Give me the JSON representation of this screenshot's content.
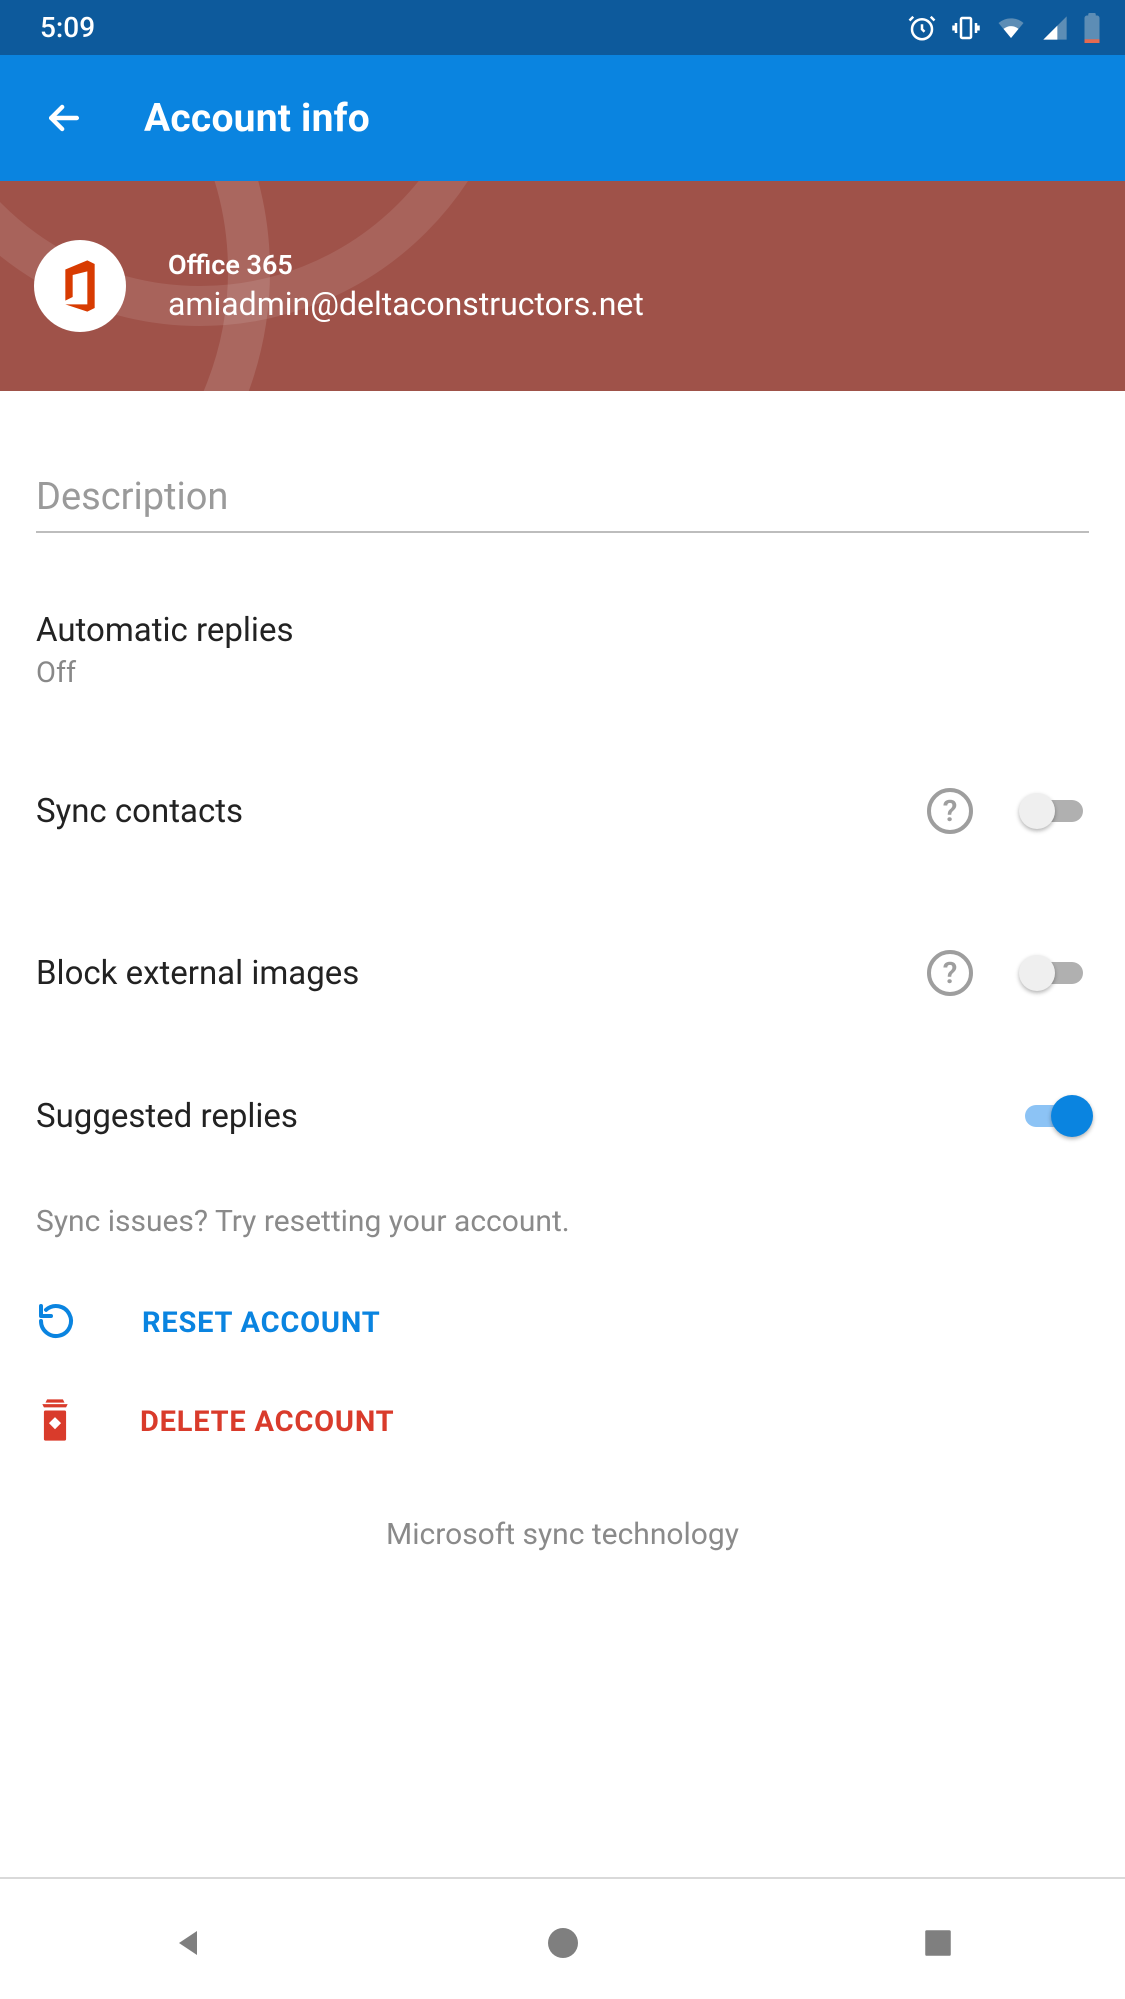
{
  "status": {
    "time": "5:09"
  },
  "header": {
    "title": "Account info"
  },
  "account": {
    "service": "Office 365",
    "email": "amiadmin@deltaconstructors.net"
  },
  "description": {
    "placeholder": "Description",
    "value": ""
  },
  "settings": {
    "auto_replies": {
      "label": "Automatic replies",
      "value": "Off"
    },
    "sync_contacts": {
      "label": "Sync contacts",
      "on": false
    },
    "block_images": {
      "label": "Block external images",
      "on": false
    },
    "suggested": {
      "label": "Suggested replies",
      "on": true
    }
  },
  "sync_hint": "Sync issues? Try resetting your account.",
  "actions": {
    "reset": "RESET ACCOUNT",
    "delete": "DELETE ACCOUNT"
  },
  "footer": "Microsoft sync technology",
  "colors": {
    "primary": "#0a84e0",
    "danger": "#d93b2b",
    "banner": "#9f5249"
  }
}
